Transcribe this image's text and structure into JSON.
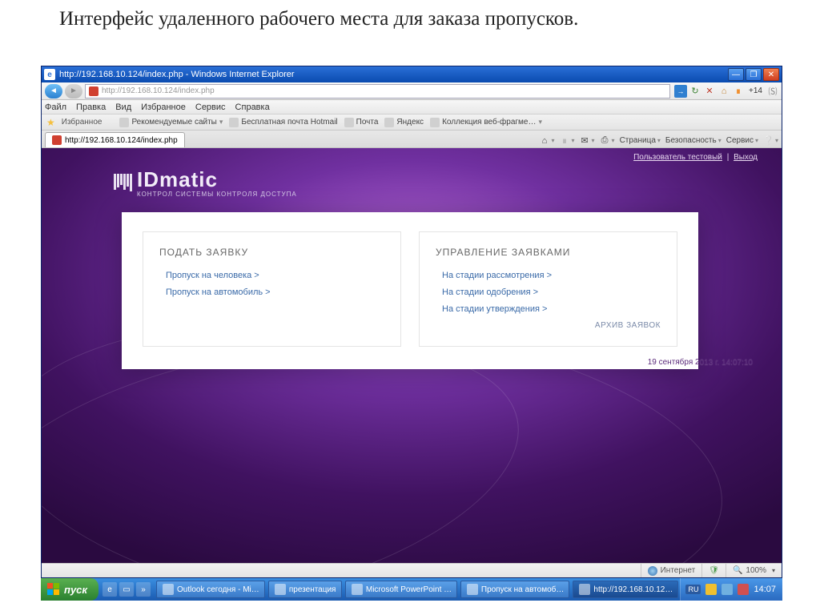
{
  "slide": {
    "heading": "Интерфейс удаленного рабочего места для заказа пропусков."
  },
  "ie": {
    "title": "http://192.168.10.124/index.php - Windows Internet Explorer",
    "url": "http://192.168.10.124/index.php",
    "menu": {
      "file": "Файл",
      "edit": "Правка",
      "view": "Вид",
      "favorites": "Избранное",
      "tools": "Сервис",
      "help": "Справка"
    },
    "fav_label": "Избранное",
    "fav_links": {
      "recommended": "Рекомендуемые сайты",
      "hotmail": "Бесплатная почта Hotmail",
      "pochta": "Почта",
      "yandex": "Яндекс",
      "webfrag": "Коллекция веб-фрагме…"
    },
    "tab_label": "http://192.168.10.124/index.php",
    "tab_tools": {
      "page": "Страница",
      "safety": "Безопасность",
      "service": "Сервис"
    },
    "counter": "+14",
    "status": {
      "internet": "Интернет",
      "zoom": "100%"
    }
  },
  "page": {
    "user_label": "Пользователь тестовый",
    "logout": "Выход",
    "logo_main": "IDmatic",
    "logo_sub": "КОНТРОЛ  СИСТЕМЫ КОНТРОЛЯ ДОСТУПА",
    "card1": {
      "title": "ПОДАТЬ ЗАЯВКУ",
      "links": [
        "Пропуск на человека  >",
        "Пропуск на автомобиль  >"
      ]
    },
    "card2": {
      "title": "УПРАВЛЕНИЕ ЗАЯВКАМИ",
      "links": [
        "На стадии рассмотрения  >",
        "На стадии одобрения  >",
        "На стадии утверждения  >"
      ],
      "archive": "АРХИВ ЗАЯВОК"
    },
    "timestamp": "19 сентября 2013 г. 14:07:10"
  },
  "taskbar": {
    "start": "пуск",
    "tasks": [
      "Outlook сегодня - Mi…",
      "презентация",
      "Microsoft PowerPoint …",
      "Пропуск на автомоб…",
      "http://192.168.10.12…"
    ],
    "lang": "RU",
    "clock": "14:07"
  }
}
